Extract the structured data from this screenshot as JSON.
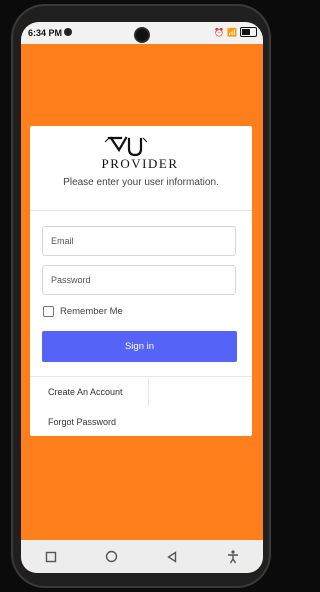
{
  "status_bar": {
    "time": "6:34 PM",
    "icons_right": "⏰ 📶",
    "battery": ""
  },
  "logo": {
    "mark": "YU",
    "word": "PROVIDER"
  },
  "login": {
    "instruction": "Please enter your user information.",
    "email_placeholder": "Email",
    "password_placeholder": "Password",
    "remember_label": "Remember Me",
    "signin_label": "Sign in",
    "create_account_label": "Create An Account",
    "forgot_password_label": "Forgot Password"
  },
  "colors": {
    "background": "#ff7f1c",
    "button": "#5563f6"
  }
}
